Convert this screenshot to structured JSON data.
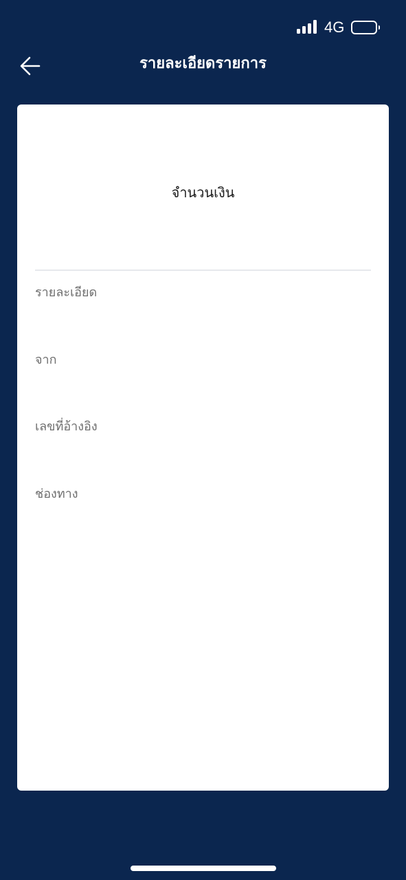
{
  "status_bar": {
    "network": "4G",
    "signal_icon": "signal-bars-icon",
    "battery_icon": "battery-icon"
  },
  "header": {
    "title": "รายละเอียดรายการ",
    "back_icon": "arrow-left-icon"
  },
  "card": {
    "amount_label": "จำนวนเงิน",
    "amount_value": "",
    "fields": [
      {
        "label": "รายละเอียด",
        "value": ""
      },
      {
        "label": "จาก",
        "value": ""
      },
      {
        "label": "เลขที่อ้างอิง",
        "value": ""
      },
      {
        "label": "ช่องทาง",
        "value": ""
      }
    ]
  },
  "colors": {
    "background": "#0b264f",
    "card": "#ffffff",
    "label_text": "#6e6e6e",
    "header_text": "#ffffff"
  }
}
